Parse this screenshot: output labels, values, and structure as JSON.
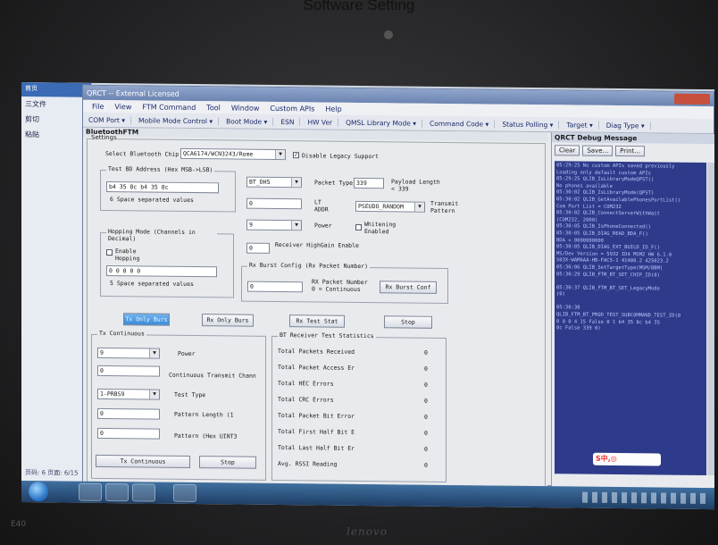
{
  "caption": "Software Setting",
  "brand": "lenovo",
  "model": "E40",
  "host_app": {
    "tab": "首页",
    "menu": "三文件",
    "items": [
      "剪切",
      "粘贴"
    ],
    "status": "页码: 6  页面: 6/15"
  },
  "window": {
    "title": "QRCT -- External Licensed",
    "menu": [
      "File",
      "View",
      "FTM Command",
      "Tool",
      "Window",
      "Custom APIs",
      "Help"
    ],
    "toolbar": [
      "COM Port ▾",
      "Mobile Mode Control ▾",
      "Boot Mode ▾",
      "ESN",
      "HW Ver",
      "QMSL Library Mode ▾",
      "Command Code ▾",
      "Status Polling ▾",
      "Target ▾",
      "Diag Type ▾"
    ]
  },
  "ftm": {
    "panel_title": "BluetoothFTM",
    "settings_legend": "Settings",
    "select_chip_label": "Select Bluetooth Chip",
    "chip_value": "QCA6174/WCN3243/Rome",
    "disable_legacy_label": "Disable Legacy Support",
    "bd_address": {
      "legend": "Test BD Address (Hex  MSB->LSB)",
      "value": "b4 35 8c b4 35 8c",
      "hint": "6 Space separated values"
    },
    "packet_type_label": "Packet Type",
    "packet_type_value": "BT_DH5",
    "payload_length_value": "339",
    "payload_length_label": "Payload Length < 339",
    "lt_addr_label": "LT ADDR",
    "lt_addr_value": "0",
    "pattern_value": "PSEUDO_RANDOM",
    "pattern_label": "Transmit Pattern",
    "power_label": "Power",
    "power_value": "9",
    "whitening_label": "Whitening Enabled",
    "hopping": {
      "legend": "Hopping Mode (Channels in Decimal)",
      "enable_label": "Enable Hopping",
      "channels": "0 0 0 0 0",
      "hint": "5 Space separated values"
    },
    "receiver_high_gain_label": "Receiver HighGain Enable",
    "receiver_high_gain_value": "0",
    "rx_burst": {
      "legend": "Rx Burst Config (Rx Packet Number)",
      "packets_value": "0",
      "packets_label": "RX Packet Number 0 = Continuous",
      "conf_button": "Rx Burst Conf"
    },
    "buttons": {
      "tx_only": "Tx Only Burs",
      "rx_only": "Rx Only Burs",
      "rx_test_stat": "Rx Test Stat",
      "stop": "Stop"
    },
    "tx_continuous": {
      "legend": "Tx Continuous",
      "power_value": "9",
      "power_label": "Power",
      "channel_value": "0",
      "channel_label": "Continuous Transmit Chann",
      "test_type_value": "1-PRBS9",
      "test_type_label": "Test Type",
      "pattern_length_value": "0",
      "pattern_length_label": "Pattern Length (1",
      "pattern_value": "0",
      "pattern_label": "Pattern (Hex UINT3",
      "tx_button": "Tx Continuous",
      "stop_button": "Stop"
    },
    "rx_stats": {
      "legend": "BT Receiver Test Statistics",
      "rows": [
        {
          "label": "Total Packets Received",
          "value": "0"
        },
        {
          "label": "Total Packet Access Er",
          "value": "0"
        },
        {
          "label": "Total HEC Errors",
          "value": "0"
        },
        {
          "label": "Total CRC Errors",
          "value": "0"
        },
        {
          "label": "Total Packet Bit Error",
          "value": "0"
        },
        {
          "label": "Total First Half Bit E",
          "value": "0"
        },
        {
          "label": "Total Last Half Bit Er",
          "value": "0"
        },
        {
          "label": "Avg. RSSI Reading",
          "value": "0"
        }
      ]
    }
  },
  "debug": {
    "title": "QRCT Debug Message",
    "buttons": [
      "Clear",
      "Save...",
      "Print..."
    ],
    "lines": [
      "05:29:25  No custom APIs saved previously",
      "Loading only default custom APIs",
      "05:29:25  QLIB_IsLibraryModeQPST()",
      "No phones available",
      "05:30:02  QLIB_IsLibraryMode(QPST)",
      "05:30:02  QLIB_GetAvailablePhonesPortList()",
      "Com Port List = COM232",
      "05:30:02  QLIB_ConnectServerWithWait",
      "(COM232, 2000)",
      "05:30:05  QLIB_IsPhoneConnected()",
      "05:30:05  QLIB_DIAG_READ_BDA_F()",
      "BDA = 0000000000",
      "05:30:05  QLIB_DIAG_EXT_BUILD_ID_F()",
      "MS/Dev Version = 5932  ID4  MSM2 HW 6.1.0",
      "S03X-WAMAAA-HB-FAC5-1 41480.2 425023.2",
      "05:30:06  QLIB_SetTargetType(MSM/BBM)",
      "05:30:29  QLIB_FTM_BT_SET_CHIP_ID(0)",
      "",
      "05:30:37  QLIB_FTM_BT_SET_LegacyMode",
      "(0)",
      "",
      "05:30:38",
      "QLIB_FTM_BT_PROD_TEST_SUBCOMMAND_TEST_ID(0",
      "0 0 0 4 15 False 0 1 b4 35 8c b4 35",
      "8c False 339 0)"
    ]
  },
  "ime": "S中,◎"
}
